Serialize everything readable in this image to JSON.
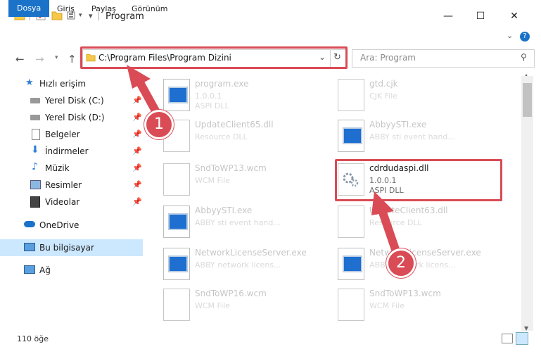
{
  "window": {
    "title": "Program",
    "minimize": "—",
    "maximize": "☐",
    "close": "✕"
  },
  "ribbon": {
    "tabs": [
      "Dosya",
      "Giriş",
      "Paylaş",
      "Görünüm"
    ]
  },
  "nav": {
    "address": "C:\\Program Files\\Program Dizini",
    "search_placeholder": "Ara: Program"
  },
  "sidebar": {
    "items": [
      {
        "label": "Hızlı erişim"
      },
      {
        "label": "Yerel Disk (C:)"
      },
      {
        "label": "Yerel Disk (D:)"
      },
      {
        "label": "Belgeler"
      },
      {
        "label": "İndirmeler"
      },
      {
        "label": "Müzik"
      },
      {
        "label": "Resimler"
      },
      {
        "label": "Videolar"
      },
      {
        "label": "OneDrive"
      },
      {
        "label": "Bu bilgisayar"
      },
      {
        "label": "Ağ"
      }
    ]
  },
  "files": [
    {
      "name": "program.exe",
      "version": "1.0.0.1",
      "type": "ASPI DLL"
    },
    {
      "name": "gtd.cjk",
      "version": "",
      "type": "CJK File"
    },
    {
      "name": "UpdateClient65.dll",
      "version": "",
      "type": "Resource DLL"
    },
    {
      "name": "AbbyySTI.exe",
      "version": "",
      "type": "ABBY sti event hand..."
    },
    {
      "name": "SndToWP13.wcm",
      "version": "",
      "type": "WCM File"
    },
    {
      "name": "cdrdudaspi.dll",
      "version": "1.0.0.1",
      "type": "ASPI DLL"
    },
    {
      "name": "AbbyySTI.exe",
      "version": "",
      "type": "ABBY sti event hand..."
    },
    {
      "name": "UpdateClient63.dll",
      "version": "",
      "type": "Resource DLL"
    },
    {
      "name": "NetworkLicenseServer.exe",
      "version": "",
      "type": "ABBY network licens..."
    },
    {
      "name": "NetworkLicenseServer.exe",
      "version": "",
      "type": "ABBY network licens..."
    },
    {
      "name": "SndToWP16.wcm",
      "version": "",
      "type": "WCM File"
    },
    {
      "name": "SndToWP13.wcm",
      "version": "",
      "type": "WCM File"
    }
  ],
  "status": {
    "count": "110 öğe"
  },
  "annotations": {
    "badge1": "1",
    "badge2": "2"
  },
  "colors": {
    "accent": "#1a73c8",
    "highlight_red": "#d94b55",
    "selected_bg": "#cce8ff"
  }
}
